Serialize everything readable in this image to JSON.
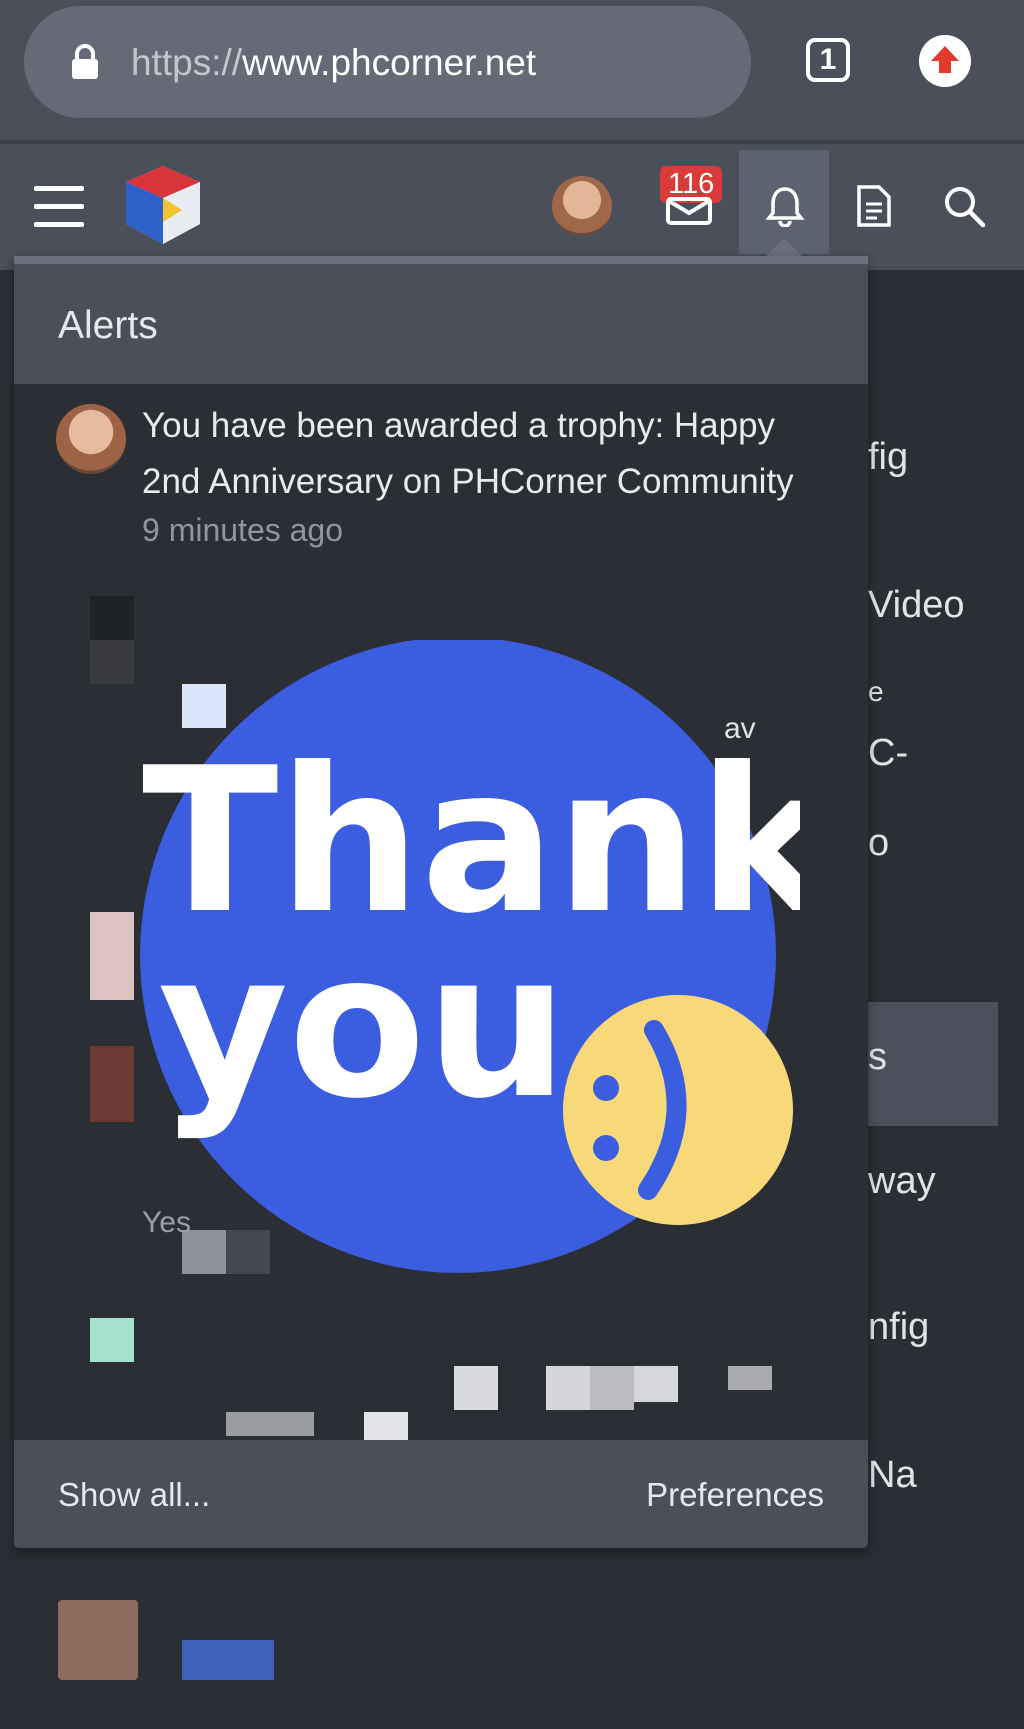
{
  "browser": {
    "url_scheme": "https://",
    "url_host": "www.phcorner.net",
    "tab_count": "1"
  },
  "header": {
    "inbox_badge": "116"
  },
  "alerts": {
    "title": "Alerts",
    "items": [
      {
        "text": "You have been awarded a trophy: Happy 2nd Anniversary on PHCorner Community",
        "time": "9 minutes ago"
      }
    ],
    "partial_text_1": "av",
    "partial_text_2": "Yes",
    "show_all": "Show all...",
    "preferences": "Preferences"
  },
  "background": {
    "fragments": [
      "fig",
      "Video",
      "e",
      "C-",
      "o",
      "s",
      "way",
      "nfig",
      "Na"
    ]
  },
  "sticker": {
    "line1": "Thank",
    "line2": "you",
    "colors": {
      "circle": "#3b5de0",
      "smiley": "#f7d97a",
      "text": "#ffffff"
    }
  },
  "colors": {
    "header_bg": "#4a4f5a",
    "page_bg": "#2b2e35",
    "badge": "#d93a3a"
  }
}
